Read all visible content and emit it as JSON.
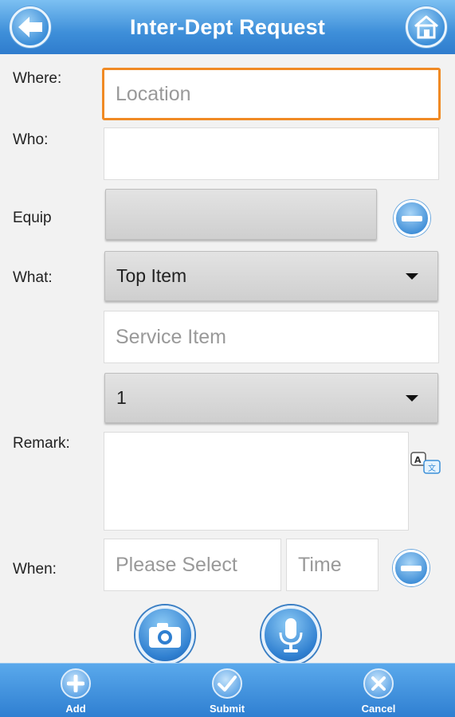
{
  "header": {
    "title": "Inter-Dept Request",
    "back_icon": "back-arrow-icon",
    "home_icon": "home-icon"
  },
  "form": {
    "where": {
      "label": "Where:",
      "placeholder": "Location"
    },
    "who": {
      "label": "Who:",
      "value": ""
    },
    "equip": {
      "label": "Equip",
      "value": ""
    },
    "what": {
      "label": "What:",
      "selected": "Top Item"
    },
    "service": {
      "placeholder": "Service Item"
    },
    "quantity": {
      "selected": "1"
    },
    "remark": {
      "label": "Remark:",
      "value": ""
    },
    "when": {
      "label": "When:",
      "date_placeholder": "Please Select",
      "time_placeholder": "Time"
    }
  },
  "actions": {
    "camera_icon": "camera-icon",
    "microphone_icon": "microphone-icon"
  },
  "footer": {
    "add_label": "Add",
    "submit_label": "Submit",
    "cancel_label": "Cancel"
  },
  "colors": {
    "header_blue": "#3e8fd9",
    "focus_orange": "#f08a24",
    "footer_blue": "#2f7fd1"
  }
}
